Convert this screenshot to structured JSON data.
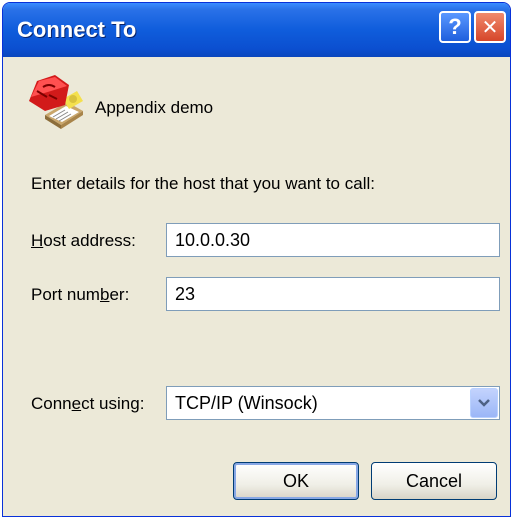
{
  "window": {
    "title": "Connect To",
    "help_glyph": "?",
    "close_glyph": "✕"
  },
  "connection": {
    "name": "Appendix demo",
    "icon": "telephone-icon"
  },
  "instructions": "Enter details for the host that you want to call:",
  "host": {
    "label_pre": "",
    "label_mnemonic": "H",
    "label_post": "ost address:",
    "value": "10.0.0.30"
  },
  "port": {
    "label_pre": "Port num",
    "label_mnemonic": "b",
    "label_post": "er:",
    "value": "23"
  },
  "connect_using": {
    "label_pre": "Conn",
    "label_mnemonic": "e",
    "label_post": "ct using:",
    "selected": "TCP/IP (Winsock)"
  },
  "buttons": {
    "ok": "OK",
    "cancel": "Cancel"
  },
  "colors": {
    "titlebar": "#0b52d6",
    "dialog_bg": "#ece9d8",
    "close_button": "#d6462a",
    "field_border": "#7f9db9"
  }
}
